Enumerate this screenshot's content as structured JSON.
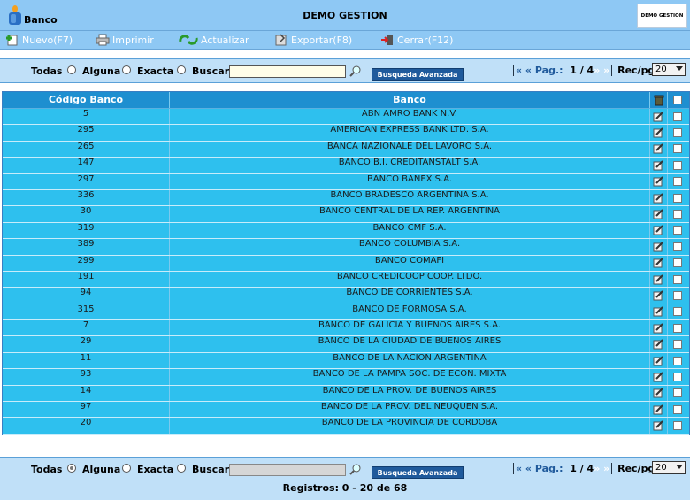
{
  "header": {
    "app_title": "Banco",
    "center_title": "DEMO GESTION",
    "brand_text": "DEMO GESTION"
  },
  "toolbar": {
    "new_label": "Nuevo(F7)",
    "print_label": "Imprimir",
    "refresh_label": "Actualizar",
    "export_label": "Exportar(F8)",
    "close_label": "Cerrar(F12)"
  },
  "filter": {
    "opt_all": "Todas",
    "opt_any": "Alguna",
    "opt_exact": "Exacta",
    "search_label": "Buscar",
    "search_value": "",
    "advanced_label": "Busqueda Avanzada",
    "pager_prev": "« «",
    "pager_label": "Pag.:",
    "pager_value": "1 / 4",
    "pager_next": "» »",
    "rec_label": "Rec/pg:",
    "rec_value": "20"
  },
  "table": {
    "col_code": "Código Banco",
    "col_name": "Banco",
    "rows": [
      {
        "code": "5",
        "name": "ABN AMRO BANK N.V."
      },
      {
        "code": "295",
        "name": "AMERICAN EXPRESS BANK LTD. S.A."
      },
      {
        "code": "265",
        "name": "BANCA NAZIONALE DEL LAVORO S.A."
      },
      {
        "code": "147",
        "name": "BANCO B.I. CREDITANSTALT S.A."
      },
      {
        "code": "297",
        "name": "BANCO BANEX S.A."
      },
      {
        "code": "336",
        "name": "BANCO BRADESCO ARGENTINA S.A."
      },
      {
        "code": "30",
        "name": "BANCO CENTRAL DE LA REP. ARGENTINA"
      },
      {
        "code": "319",
        "name": "BANCO CMF S.A."
      },
      {
        "code": "389",
        "name": "BANCO COLUMBIA S.A."
      },
      {
        "code": "299",
        "name": "BANCO COMAFI"
      },
      {
        "code": "191",
        "name": "BANCO CREDICOOP COOP. LTDO."
      },
      {
        "code": "94",
        "name": "BANCO DE CORRIENTES S.A."
      },
      {
        "code": "315",
        "name": "BANCO DE FORMOSA S.A."
      },
      {
        "code": "7",
        "name": "BANCO DE GALICIA Y BUENOS AIRES S.A."
      },
      {
        "code": "29",
        "name": "BANCO DE LA CIUDAD DE BUENOS AIRES"
      },
      {
        "code": "11",
        "name": "BANCO DE LA NACION ARGENTINA"
      },
      {
        "code": "93",
        "name": "BANCO DE LA PAMPA SOC. DE ECON. MIXTA"
      },
      {
        "code": "14",
        "name": "BANCO DE LA PROV. DE BUENOS AIRES"
      },
      {
        "code": "97",
        "name": "BANCO DE LA PROV. DEL NEUQUEN S.A."
      },
      {
        "code": "20",
        "name": "BANCO DE LA PROVINCIA DE CORDOBA"
      }
    ]
  },
  "status": {
    "records_text": "Registros: 0 - 20 de 68"
  },
  "colors": {
    "header_bg": "#8ec8f4",
    "grid_bg": "#2ec0ee",
    "grid_head_bg": "#1e8fd0",
    "button_bg": "#1f5a9c"
  }
}
